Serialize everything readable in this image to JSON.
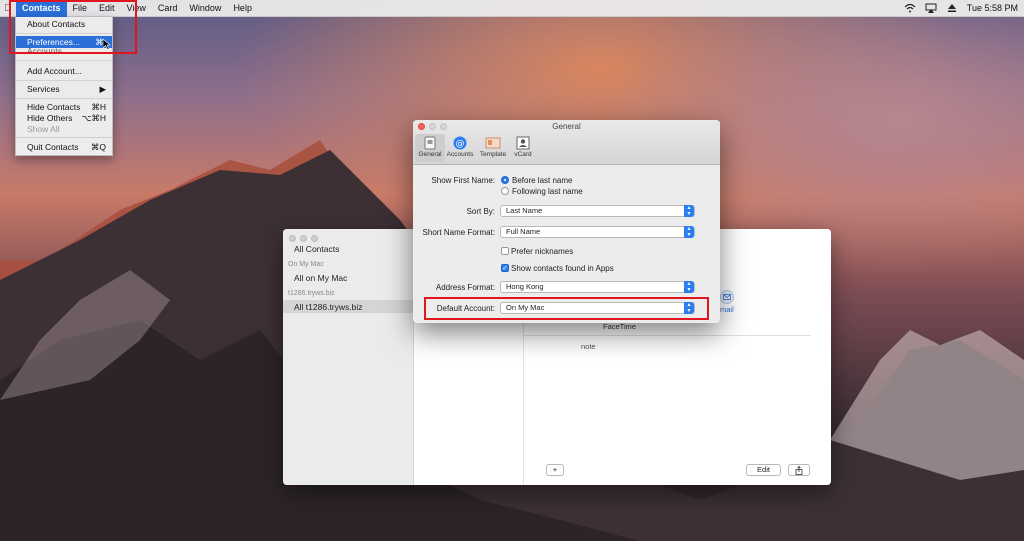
{
  "menubar": {
    "app_menu": "Contacts",
    "items": [
      "File",
      "Edit",
      "View",
      "Card",
      "Window",
      "Help"
    ],
    "clock": "Tue 5:58 PM"
  },
  "contacts_menu": {
    "items": [
      {
        "label": "About Contacts",
        "shortcut": ""
      },
      {
        "label": "Preferences...",
        "shortcut": "⌘,"
      },
      {
        "label": "Accounts...",
        "shortcut": ""
      },
      {
        "label": "Add Account...",
        "shortcut": ""
      },
      {
        "label": "Services",
        "shortcut": "▶"
      },
      {
        "label": "Hide Contacts",
        "shortcut": "⌘H"
      },
      {
        "label": "Hide Others",
        "shortcut": "⌥⌘H"
      },
      {
        "label": "Show All",
        "shortcut": ""
      },
      {
        "label": "Quit Contacts",
        "shortcut": "⌘Q"
      }
    ]
  },
  "contacts_window": {
    "sidebar": {
      "all_contacts": "All Contacts",
      "group_on_my_mac": "On My Mac",
      "all_on_my_mac": "All on My Mac",
      "group_account": "t1286.tryws.biz",
      "all_account": "All t1286.tryws.biz"
    },
    "detail": {
      "mail_label": "mail",
      "facetime_label": "FaceTime",
      "note_label": "note",
      "add_button": "+",
      "edit_button": "Edit",
      "share_icon": "share-icon"
    }
  },
  "prefs": {
    "title": "General",
    "tabs": [
      "General",
      "Accounts",
      "Template",
      "vCard"
    ],
    "show_first_name_label": "Show First Name:",
    "show_first_name_options": [
      "Before last name",
      "Following last name"
    ],
    "sort_by_label": "Sort By:",
    "sort_by_value": "Last Name",
    "short_name_label": "Short Name Format:",
    "short_name_value": "Full Name",
    "prefer_nicknames": "Prefer nicknames",
    "show_found_in_apps": "Show contacts found in Apps",
    "address_format_label": "Address Format:",
    "address_format_value": "Hong Kong",
    "default_account_label": "Default Account:",
    "default_account_value": "On My Mac"
  },
  "colors": {
    "accent": "#2b6fd8",
    "highlight_box": "#e0161f"
  }
}
